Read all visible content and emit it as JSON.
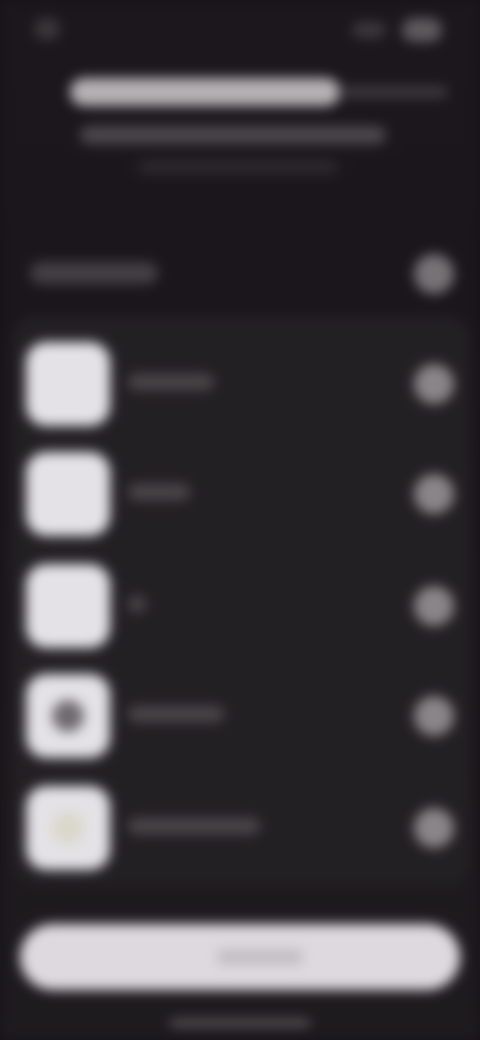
{
  "status_bar": {
    "time": "",
    "icons": [
      "signal-icon",
      "battery-icon"
    ]
  },
  "header": {
    "title": "",
    "subtitle": "",
    "caption": ""
  },
  "section": {
    "title": "",
    "action_icon": "circle-button-icon"
  },
  "apps": [
    {
      "name": "",
      "icon": "app-icon-blank",
      "glyph_color": ""
    },
    {
      "name": "",
      "icon": "app-icon-blank",
      "glyph_color": ""
    },
    {
      "name": "",
      "icon": "app-icon-blank",
      "glyph_color": ""
    },
    {
      "name": "",
      "icon": "app-icon-dark-circle",
      "glyph_color": "#6e6a70"
    },
    {
      "name": "",
      "icon": "app-icon-light-circle",
      "glyph_color": "#d9d8c9"
    }
  ],
  "primary_button": {
    "label": ""
  },
  "colors": {
    "background": "#1b171c",
    "panel": "#232024",
    "button": "#ddd9de",
    "icon_tile": "#e4e2e6",
    "row_action": "#8a8589"
  }
}
